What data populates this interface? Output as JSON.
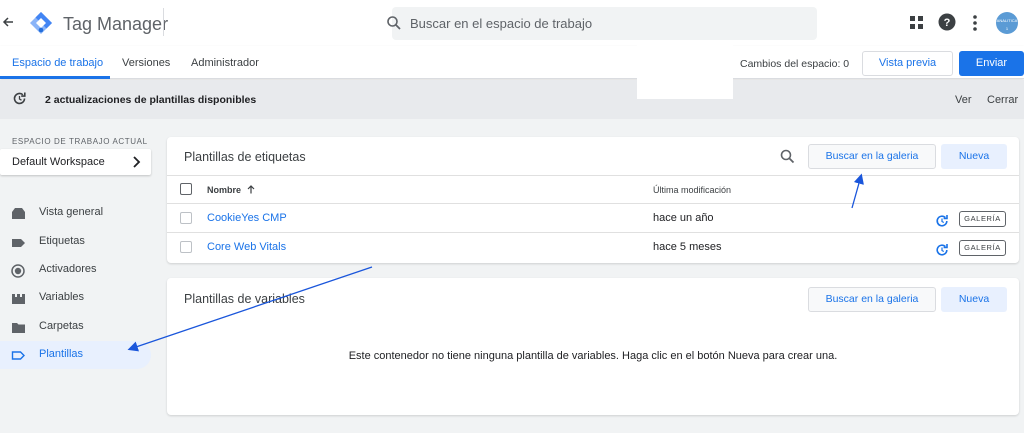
{
  "header": {
    "app_title": "Tag Manager",
    "search_placeholder": "Buscar en el espacio de trabajo",
    "avatar_text": "ANALITICA 1",
    "icons": [
      "back-arrow-icon",
      "tag-manager-logo-icon",
      "search-icon",
      "apps-grid-icon",
      "help-icon",
      "more-vert-icon"
    ]
  },
  "tabs": {
    "workspace": "Espacio de trabajo",
    "versions": "Versiones",
    "admin": "Administrador"
  },
  "toolbar": {
    "changes_label": "Cambios del espacio: 0",
    "preview_label": "Vista previa",
    "send_label": "Enviar"
  },
  "notice": {
    "text": "2 actualizaciones de plantillas disponibles",
    "view_label": "Ver",
    "close_label": "Cerrar"
  },
  "sidebar": {
    "workspace_heading": "ESPACIO DE TRABAJO ACTUAL",
    "workspace_name": "Default Workspace",
    "items": [
      {
        "label": "Vista general",
        "icon": "overview-icon"
      },
      {
        "label": "Etiquetas",
        "icon": "tag-icon"
      },
      {
        "label": "Activadores",
        "icon": "trigger-icon"
      },
      {
        "label": "Variables",
        "icon": "variables-icon"
      },
      {
        "label": "Carpetas",
        "icon": "folder-icon"
      },
      {
        "label": "Plantillas",
        "icon": "template-icon",
        "active": true
      }
    ]
  },
  "tag_templates": {
    "title": "Plantillas de etiquetas",
    "gallery_button": "Buscar en la galeria",
    "new_button": "Nueva",
    "columns": [
      "Nombre",
      "Última modificación"
    ],
    "rows": [
      {
        "name": "CookieYes CMP",
        "modified": "hace un año",
        "badge": "GALERÍA"
      },
      {
        "name": "Core Web Vitals",
        "modified": "hace 5 meses",
        "badge": "GALERÍA"
      }
    ]
  },
  "variable_templates": {
    "title": "Plantillas de variables",
    "gallery_button": "Buscar en la galeria",
    "new_button": "Nueva",
    "empty_message": "Este contenedor no tiene ninguna plantilla de variables. Haga clic en el botón Nueva para crear una."
  },
  "colors": {
    "accent": "#1a73e8",
    "annotation_arrow": "#1a56db",
    "notice_bg": "#e8eaed",
    "page_bg": "#f1f3f4"
  }
}
